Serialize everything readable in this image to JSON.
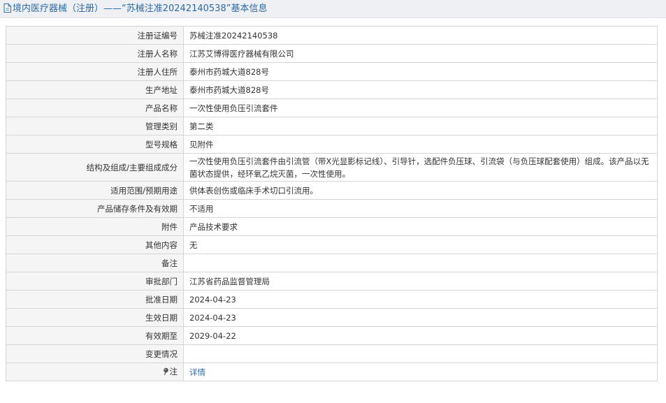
{
  "header": {
    "title": "境内医疗器械（注册）——“苏械注准20242140538”基本信息"
  },
  "rows": [
    {
      "label": "注册证编号",
      "value": "苏械注准20242140538"
    },
    {
      "label": "注册人名称",
      "value": "江苏艾博得医疗器械有限公司"
    },
    {
      "label": "注册人住所",
      "value": "泰州市药城大道828号"
    },
    {
      "label": "生产地址",
      "value": "泰州市药城大道828号"
    },
    {
      "label": "产品名称",
      "value": "一次性使用负压引流套件"
    },
    {
      "label": "管理类别",
      "value": "第二类"
    },
    {
      "label": "型号规格",
      "value": "见附件"
    },
    {
      "label": "结构及组成/主要组成成分",
      "value": "一次性使用负压引流套件由引流管（带X光显影标记线）、引导针，选配件负压球、引流袋（与负压球配套使用）组成。该产品以无菌状态提供，经环氧乙烷灭菌，一次性使用。"
    },
    {
      "label": "适用范围/预期用途",
      "value": "供体表创伤或临床手术切口引流用。"
    },
    {
      "label": "产品储存条件及有效期",
      "value": "不适用"
    },
    {
      "label": "附件",
      "value": "产品技术要求"
    },
    {
      "label": "其他内容",
      "value": "无"
    },
    {
      "label": "备注",
      "value": ""
    },
    {
      "label": "审批部门",
      "value": "江苏省药品监督管理局"
    },
    {
      "label": "批准日期",
      "value": "2024-04-23"
    },
    {
      "label": "生效日期",
      "value": "2024-04-23"
    },
    {
      "label": "有效期至",
      "value": "2029-04-22"
    },
    {
      "label": "变更情况",
      "value": ""
    }
  ],
  "note_row": {
    "label": "注",
    "link_text": "详情"
  },
  "colors": {
    "title_text": "#2b6aa6",
    "link": "#2b6aa6",
    "label_bg": "#f5f5f5",
    "border": "#d6d6d6"
  },
  "icons": {
    "title": "document-icon",
    "note": "pin-icon"
  }
}
